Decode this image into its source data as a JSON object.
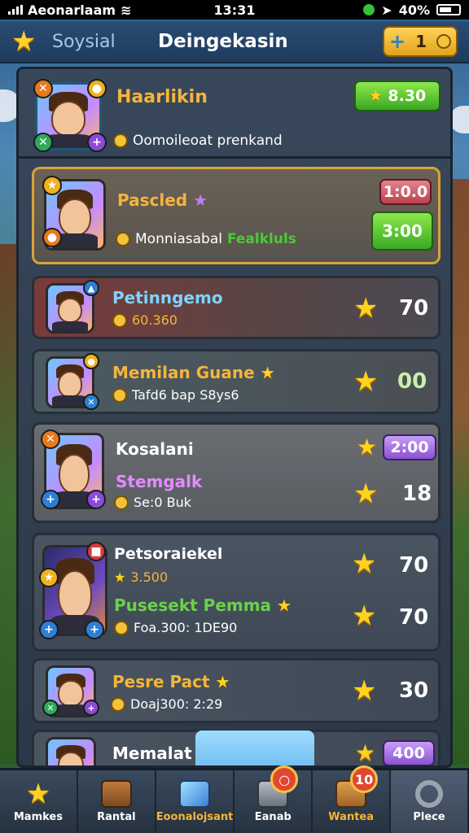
{
  "status_bar": {
    "carrier": "Aeonarlaam",
    "time": "13:31",
    "battery": "40%"
  },
  "header": {
    "subtitle": "Soysial",
    "title": "Deingekasin",
    "currency_plus": "+",
    "currency_value": "1"
  },
  "colors": {
    "gold": "#ffd21f",
    "green_pill": "#3aa823",
    "red_pill": "#b9434f",
    "purple_pill": "#8a52d1",
    "panel": "#2b3847"
  },
  "top_player": {
    "name": "Haarlikin",
    "reward": "8.30",
    "subtitle": "Oomoileoat prenkand"
  },
  "featured": {
    "name": "Pascled",
    "badge_top": "1:0.0",
    "badge_bottom": "3:00",
    "subtitle": "Monniasabal",
    "subtitle_extra": "Fealkluls"
  },
  "rows": [
    {
      "name": "Petinngemo",
      "sub": "60.360",
      "score": "70"
    },
    {
      "name": "Memilan Guane",
      "sub": "Tafd6 bap S8ys6",
      "score": "00"
    },
    {
      "name": "Kosalani",
      "pill": "2:00",
      "sub_name": "Stemgalk",
      "sub": "Se:0 Buk",
      "score": "18"
    },
    {
      "name": "Petsoraiekel",
      "line2": "3.500",
      "score": "70",
      "name2": "Pusesekt Pemma",
      "line4": "Foa.300: 1DE90",
      "score2": "70"
    },
    {
      "name": "Pesre Pact",
      "sub": "Doaj300: 2:29",
      "score": "30"
    },
    {
      "name": "Memalat",
      "pill": "400"
    }
  ],
  "nav": [
    {
      "label": "Mamkes",
      "icon": "star-icon"
    },
    {
      "label": "Rantal",
      "icon": "chest-icon"
    },
    {
      "label": "Eoonalojsant",
      "icon": "crystal-icon"
    },
    {
      "label": "Eanab",
      "icon": "box-icon"
    },
    {
      "label": "Wantea",
      "icon": "crate-icon",
      "badge": "10"
    },
    {
      "label": "Plece",
      "icon": "search-icon"
    }
  ]
}
